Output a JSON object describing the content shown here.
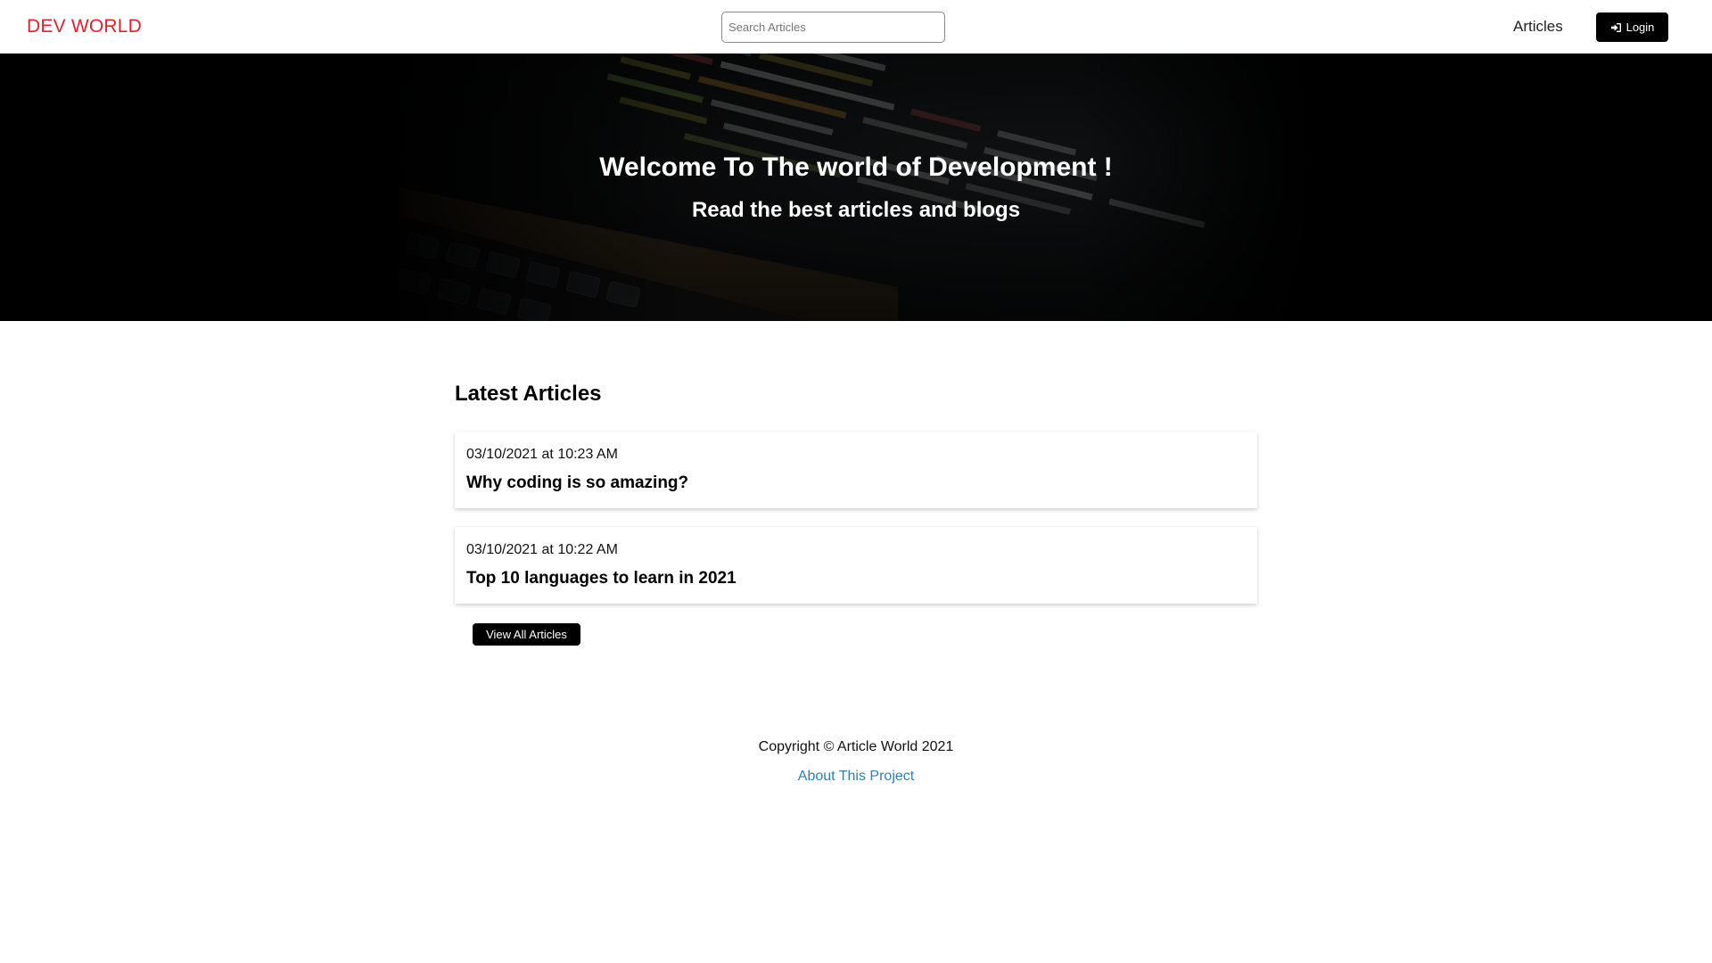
{
  "navbar": {
    "brand": "DEV WORLD",
    "search_placeholder": "Search Articles",
    "articles_link": "Articles",
    "login_label": "Login",
    "brand_color": "#e8202e"
  },
  "hero": {
    "title": "Welcome To The world of Development !",
    "subtitle": "Read the best articles and blogs",
    "background_image": "code-on-laptop-screen"
  },
  "main": {
    "section_title": "Latest Articles",
    "articles": [
      {
        "date": "03/10/2021 at 10:23 AM",
        "title": "Why coding is so amazing?"
      },
      {
        "date": "03/10/2021 at 10:22 AM",
        "title": "Top 10 languages to learn in 2021"
      }
    ],
    "view_all_label": "View All Articles"
  },
  "footer": {
    "copyright": "Copyright © Article World 2021",
    "about_link": "About This Project",
    "link_color": "#2f7fb5"
  }
}
